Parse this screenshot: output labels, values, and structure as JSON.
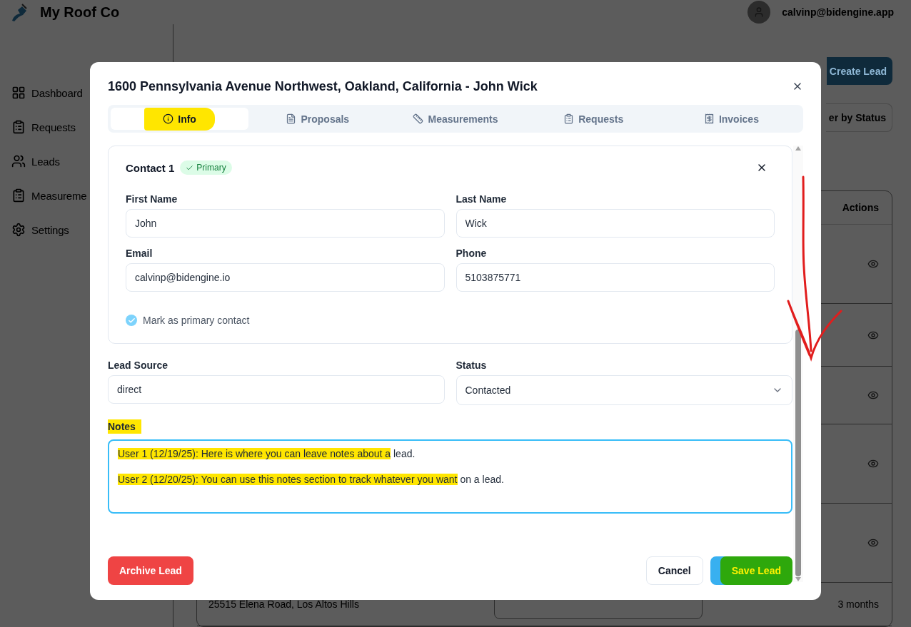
{
  "header": {
    "brand": "My Roof Co",
    "user_email": "calvinp@bidengine.app"
  },
  "sidebar": {
    "items": [
      {
        "label": "Dashboard",
        "selected": false
      },
      {
        "label": "Requests",
        "selected": false
      },
      {
        "label": "Leads",
        "selected": false
      },
      {
        "label": "Measureme",
        "selected": false
      },
      {
        "label": "Settings",
        "selected": false
      }
    ]
  },
  "main": {
    "create_button": "Create Lead",
    "filter_button": "er by Status",
    "table": {
      "columns": [
        "Actions"
      ],
      "rows": [
        {
          "kind": "action"
        },
        {
          "kind": "action"
        },
        {
          "kind": "action"
        },
        {
          "kind": "action"
        },
        {
          "kind": "action"
        },
        {
          "kind": "lead",
          "address": "25515 Elena Road, Los Altos Hills",
          "time": "3 months"
        }
      ]
    }
  },
  "modal": {
    "title": "1600 Pennsylvania Avenue Northwest, Oakland, California - John Wick",
    "tabs": [
      {
        "label": "Info",
        "selected": true,
        "highlighted": true
      },
      {
        "label": "Proposals",
        "selected": false,
        "highlighted": false
      },
      {
        "label": "Measurements",
        "selected": false,
        "highlighted": false
      },
      {
        "label": "Requests",
        "selected": false,
        "highlighted": false
      },
      {
        "label": "Invoices",
        "selected": false,
        "highlighted": false
      }
    ],
    "contact": {
      "title": "Contact 1",
      "badge": "Primary",
      "fields": [
        {
          "label": "First Name",
          "value": "John"
        },
        {
          "label": "Last Name",
          "value": "Wick"
        },
        {
          "label": "Email",
          "value": "calvinp@bidengine.io"
        },
        {
          "label": "Phone",
          "value": "5103875771"
        }
      ],
      "primary_checkbox": {
        "label": "Mark as primary contact",
        "checked": true
      }
    },
    "lead_source": {
      "label": "Lead Source",
      "value": "direct"
    },
    "status": {
      "label": "Status",
      "value": "Contacted"
    },
    "notes": {
      "label": "Notes",
      "highlighted": true,
      "lines": [
        {
          "highlighted": "User 1 (12/19/25): Here is where you can leave notes about a",
          "rest": "lead."
        },
        {
          "highlighted": "User 2 (12/20/25): You can use this notes section to track whatever you want",
          "rest": "on a lead."
        }
      ]
    },
    "buttons": {
      "archive": "Archive Lead",
      "cancel": "Cancel",
      "save": {
        "label": "Save Lead",
        "highlighted": true
      }
    }
  }
}
